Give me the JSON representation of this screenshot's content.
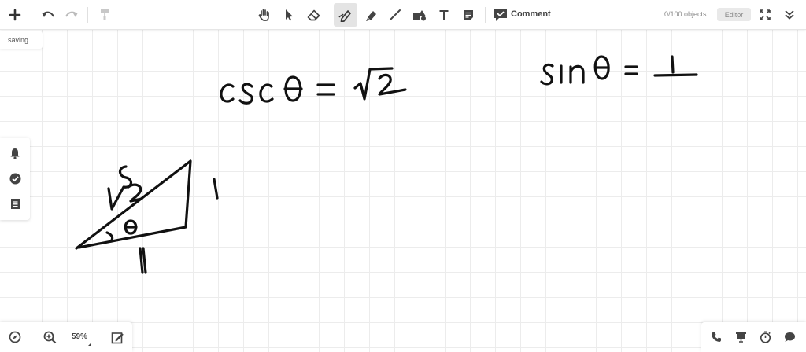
{
  "toolbar": {
    "comment_label": "Comment",
    "objects_count": "0/100 objects",
    "editor_label": "Editor"
  },
  "status": {
    "saving_text": "saving..."
  },
  "zoom": {
    "level": "59%"
  },
  "colors": {
    "active_tool_bg": "#e4e4e4",
    "grid_line": "#ececec",
    "ink": "#111111"
  }
}
